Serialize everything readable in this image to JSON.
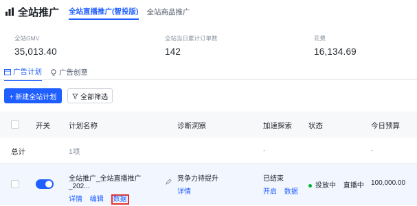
{
  "header": {
    "title": "全站推广",
    "tabs": [
      {
        "label": "全站直播推广(智投版)",
        "active": true
      },
      {
        "label": "全站商品推广",
        "active": false
      }
    ]
  },
  "metrics": [
    {
      "label": "全站GMV",
      "value": "35,013.40"
    },
    {
      "label": "全站当日累计订单数",
      "value": "142"
    },
    {
      "label": "花费",
      "value": "16,134.69"
    }
  ],
  "subtabs": [
    {
      "label": "广告计划",
      "active": true,
      "icon": "calendar-icon"
    },
    {
      "label": "广告创意",
      "active": false,
      "icon": "bulb-icon"
    }
  ],
  "toolbar": {
    "new_label": "+ 新建全站计划",
    "filter_label": "全部筛选"
  },
  "table": {
    "headers": [
      "开关",
      "计划名称",
      "诊断洞察",
      "加速探索",
      "状态",
      "今日预算"
    ],
    "total_row": {
      "label": "总计",
      "name_col": "1项",
      "speed_col": "-",
      "budget_col": "-"
    },
    "rows": [
      {
        "name": "全站推广_全站直播推广_202...",
        "name_actions": [
          "详情",
          "编辑",
          "数据"
        ],
        "insight": "竞争力待提升",
        "insight_action": "详情",
        "speed": "已结束",
        "speed_actions": [
          "开启",
          "数据"
        ],
        "status_primary": "投放中",
        "status_secondary": "直播中",
        "budget": "100,000.00"
      }
    ]
  },
  "colors": {
    "accent": "#1f5eff",
    "highlight": "#e8302a",
    "status_ok": "#00b42a"
  }
}
